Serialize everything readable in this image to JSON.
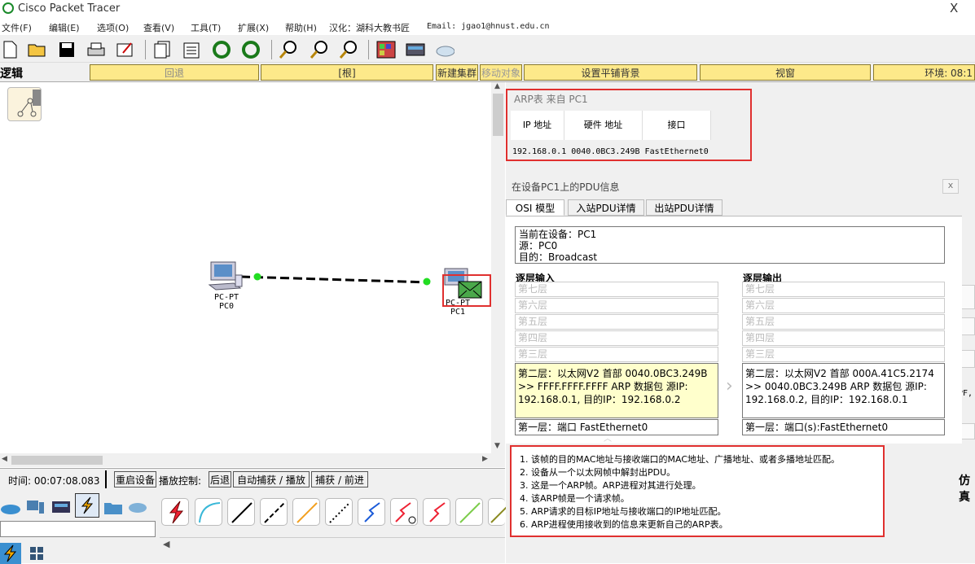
{
  "window": {
    "title": "Cisco Packet Tracer",
    "close": "X"
  },
  "menu": [
    "文件(F)",
    "编辑(E)",
    "选项(O)",
    "查看(V)",
    "工具(T)",
    "扩展(X)",
    "帮助(H)",
    "汉化：湖科大教书匠",
    "Email: jgao1@hnust.edu.cn"
  ],
  "logical": {
    "label": "逻辑",
    "back": "回退",
    "root": "[根]",
    "new_cluster": "新建集群",
    "move_object": "移动对象",
    "set_bg": "设置平铺背景",
    "viewport": "视窗",
    "env": "环境: 08:1"
  },
  "devices": {
    "pc0": {
      "type": "PC-PT",
      "name": "PC0"
    },
    "pc1": {
      "type": "PC-PT",
      "name": "PC1"
    }
  },
  "arp": {
    "title": "ARP表 来自 PC1",
    "col_ip": "IP 地址",
    "col_hw": "硬件 地址",
    "col_if": "接口",
    "row": "192.168.0.1  0040.0BC3.249B FastEthernet0"
  },
  "pdu": {
    "title": "在设备PC1上的PDU信息",
    "close": "x",
    "tabs": [
      "OSI 模型",
      "入站PDU详情",
      "出站PDU详情"
    ],
    "info": [
      "当前在设备：PC1",
      "源：PC0",
      "目的：Broadcast"
    ],
    "in_header": "逐层输入",
    "out_header": "逐层输出",
    "layers": [
      "第七层",
      "第六层",
      "第五层",
      "第四层",
      "第三层"
    ],
    "in_l2": "第二层：以太网V2 首部 0040.0BC3.249B >> FFFF.FFFF.FFFF ARP 数据包 源IP: 192.168.0.1, 目的IP：192.168.0.2",
    "out_l2": "第二层：以太网V2 首部 000A.41C5.2174 >> 0040.0BC3.249B ARP 数据包 源IP: 192.168.0.2, 目的IP：192.168.0.1",
    "in_l1": "第一层：端口 FastEthernet0",
    "out_l1": "第一层：端口(s):FastEthernet0"
  },
  "notes": [
    "1. 该帧的目的MAC地址与接收端口的MAC地址、广播地址、或者多播地址匹配。",
    "2. 设备从一个以太网帧中解封出PDU。",
    "3. 这是一个ARP帧。ARP进程对其进行处理。",
    "4. 该ARP帧是一个请求帧。",
    "5. ARP请求的目标IP地址与接收端口的IP地址匹配。",
    "6. ARP进程使用接收到的信息来更新自己的ARP表。"
  ],
  "status": {
    "time": "时间: 00:07:08.083",
    "reset": "重启设备",
    "playback": "播放控制:",
    "back": "后退",
    "auto": "自动捕获 / 播放",
    "capture": "捕获 / 前进"
  },
  "right_edge": {
    "pf": "PF,",
    "sim": "仿真"
  }
}
